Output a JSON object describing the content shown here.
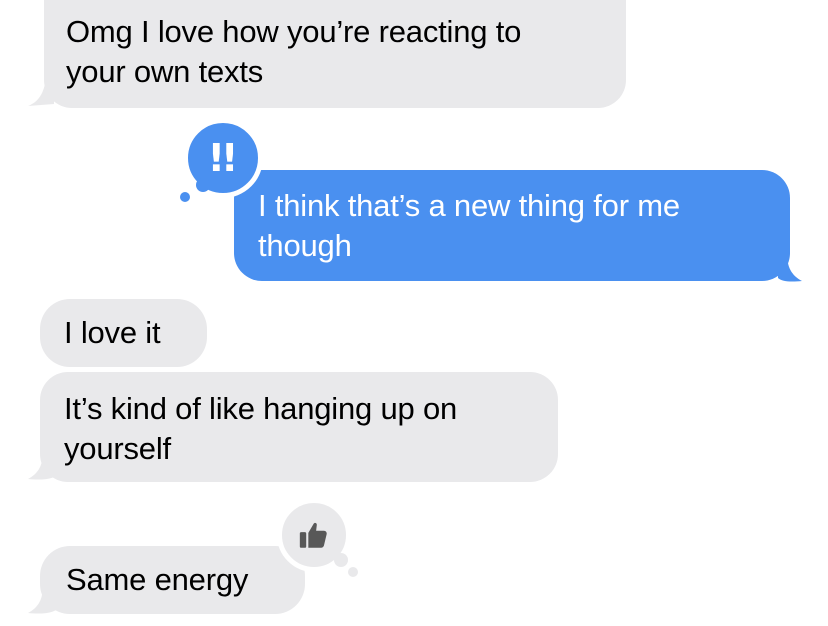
{
  "colors": {
    "incoming_bubble": "#e9e9eb",
    "outgoing_bubble": "#4a90f0",
    "reaction_thumb_bg": "#e9e9eb",
    "thumb_icon": "#585858"
  },
  "messages": [
    {
      "direction": "incoming",
      "lines": [
        "Omg I love how you’re reacting to",
        "your own texts"
      ]
    },
    {
      "direction": "outgoing",
      "lines": [
        "I think that’s a new thing for me",
        "though"
      ],
      "reaction": {
        "icon": "double-exclamation-icon",
        "glyph": "!!"
      }
    },
    {
      "direction": "incoming",
      "lines": [
        "I love it"
      ]
    },
    {
      "direction": "incoming",
      "lines": [
        "It’s kind of like hanging up on",
        "yourself"
      ]
    },
    {
      "direction": "incoming",
      "lines": [
        "Same energy"
      ],
      "reaction": {
        "icon": "thumbs-up-icon"
      }
    }
  ]
}
